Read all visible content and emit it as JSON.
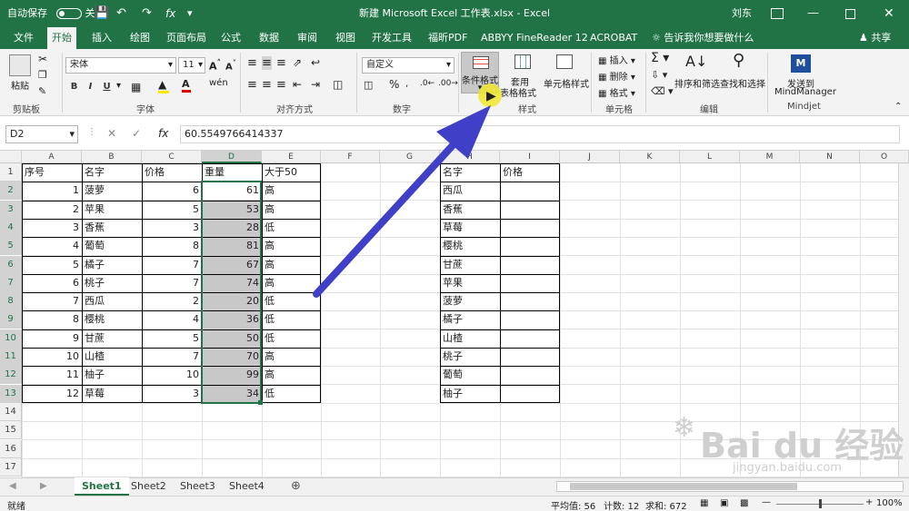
{
  "titlebar": {
    "autosave": "自动保存",
    "autosave_state": "关",
    "title": "新建 Microsoft Excel 工作表.xlsx  -  Excel",
    "user": "刘东"
  },
  "tabs": [
    "文件",
    "开始",
    "插入",
    "绘图",
    "页面布局",
    "公式",
    "数据",
    "审阅",
    "视图",
    "开发工具",
    "福昕PDF",
    "ABBYY FineReader 12",
    "ACROBAT"
  ],
  "tell_me": "告诉我你想要做什么",
  "share": "共享",
  "ribbon": {
    "paste": "粘贴",
    "clipboard": "剪贴板",
    "font_name": "宋体",
    "font_size": "11",
    "font_group": "字体",
    "bold": "B",
    "italic": "I",
    "underline": "U",
    "align_group": "对齐方式",
    "number_format": "自定义",
    "number_group": "数字",
    "percent": "%",
    "cond_format": "条件格式",
    "table_fmt_1": "套用",
    "table_fmt_2": "表格格式",
    "cell_style": "单元格样式",
    "style_group": "样式",
    "insert": "插入",
    "delete": "删除",
    "format": "格式",
    "cells_group": "单元格",
    "sort_filter": "排序和筛选",
    "find_select": "查找和选择",
    "edit_group": "编辑",
    "mindjet_1": "发送到",
    "mindjet_2": "MindManager",
    "mindjet_group": "Mindjet"
  },
  "formula": {
    "namebox": "D2",
    "fx": "fx",
    "value": "60.5549766414337"
  },
  "columns": [
    "A",
    "B",
    "C",
    "D",
    "E",
    "F",
    "G",
    "H",
    "I",
    "J",
    "K",
    "L",
    "M",
    "N",
    "O"
  ],
  "rows": [
    "1",
    "2",
    "3",
    "4",
    "5",
    "6",
    "7",
    "8",
    "9",
    "10",
    "11",
    "12",
    "13",
    "14",
    "15",
    "16",
    "17"
  ],
  "table1": {
    "headers": [
      "序号",
      "名字",
      "价格",
      "重量",
      "大于50"
    ],
    "rows": [
      [
        "1",
        "菠萝",
        "6",
        "61",
        "高"
      ],
      [
        "2",
        "苹果",
        "5",
        "53",
        "高"
      ],
      [
        "3",
        "香蕉",
        "3",
        "28",
        "低"
      ],
      [
        "4",
        "葡萄",
        "8",
        "81",
        "高"
      ],
      [
        "5",
        "橘子",
        "7",
        "67",
        "高"
      ],
      [
        "6",
        "桃子",
        "7",
        "74",
        "高"
      ],
      [
        "7",
        "西瓜",
        "2",
        "20",
        "低"
      ],
      [
        "8",
        "樱桃",
        "4",
        "36",
        "低"
      ],
      [
        "9",
        "甘蔗",
        "5",
        "50",
        "低"
      ],
      [
        "10",
        "山楂",
        "7",
        "70",
        "高"
      ],
      [
        "11",
        "柚子",
        "10",
        "99",
        "高"
      ],
      [
        "12",
        "草莓",
        "3",
        "34",
        "低"
      ]
    ]
  },
  "table2": {
    "headers": [
      "名字",
      "价格"
    ],
    "names": [
      "西瓜",
      "香蕉",
      "草莓",
      "樱桃",
      "甘蔗",
      "苹果",
      "菠萝",
      "橘子",
      "山楂",
      "桃子",
      "葡萄",
      "柚子"
    ]
  },
  "sheets": [
    "Sheet1",
    "Sheet2",
    "Sheet3",
    "Sheet4"
  ],
  "status": {
    "ready": "就绪",
    "average": "平均值: 56",
    "count": "计数: 12",
    "sum": "求和: 672",
    "zoom": "100%"
  },
  "watermark": {
    "text": "Bai du 经验",
    "url": "jingyan.baidu.com"
  },
  "colors": {
    "excel_green": "#217346",
    "arrow": "#3f3fc8",
    "highlight": "#f0e62a",
    "selection_fill": "#c8c8c8"
  }
}
